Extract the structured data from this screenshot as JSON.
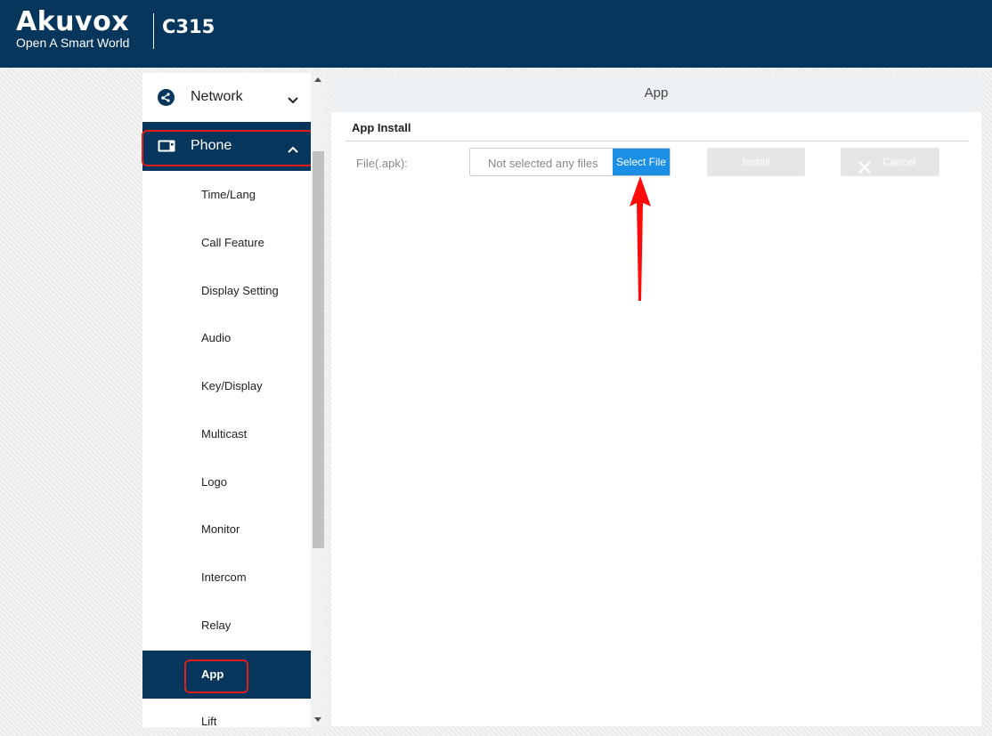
{
  "header": {
    "brand": "Akuvox",
    "tagline": "Open A Smart World",
    "model": "C315"
  },
  "sidebar": {
    "network": {
      "label": "Network",
      "icon": "network-icon"
    },
    "phone": {
      "label": "Phone",
      "icon": "phone-device-icon"
    },
    "items": [
      {
        "label": "Time/Lang"
      },
      {
        "label": "Call Feature"
      },
      {
        "label": "Display Setting"
      },
      {
        "label": "Audio"
      },
      {
        "label": "Key/Display"
      },
      {
        "label": "Multicast"
      },
      {
        "label": "Logo"
      },
      {
        "label": "Monitor"
      },
      {
        "label": "Intercom"
      },
      {
        "label": "Relay"
      },
      {
        "label": "App"
      },
      {
        "label": "Lift"
      }
    ],
    "active_item": "App"
  },
  "main": {
    "title": "App",
    "section_title": "App Install",
    "field_label": "File(.apk):",
    "file_placeholder": "Not selected any files",
    "select_file_label": "Select File",
    "install_label": "Install",
    "cancel_label": "Cancel"
  },
  "colors": {
    "header_bg": "#06365c",
    "accent": "#1b8ee6",
    "highlight": "#e21b1b"
  }
}
